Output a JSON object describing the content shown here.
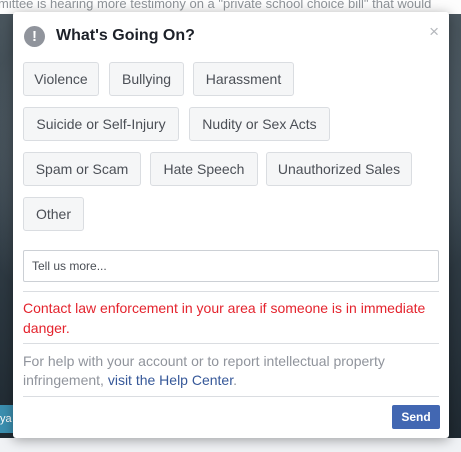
{
  "background": {
    "headline": "mittee is hearing more testimony on a \"private school choice bill\" that would",
    "left_tab_text": "ya"
  },
  "dialog": {
    "title": "What's Going On?",
    "alert_glyph": "!",
    "close_glyph": "×",
    "tags": [
      {
        "label": "Violence"
      },
      {
        "label": "Bullying"
      },
      {
        "label": "Harassment"
      },
      {
        "label": "Suicide or Self-Injury"
      },
      {
        "label": "Nudity or Sex Acts"
      },
      {
        "label": "Spam or Scam"
      },
      {
        "label": "Hate Speech"
      },
      {
        "label": "Unauthorized Sales"
      },
      {
        "label": "Other"
      }
    ],
    "details_placeholder": "Tell us more...",
    "warning": "Contact law enforcement in your area if someone is in immediate danger.",
    "help_text": "For help with your account or to report intellectual property infringement,",
    "help_link": "visit the Help Center",
    "help_suffix": ".",
    "send_label": "Send"
  },
  "colors": {
    "warning": "#e4232d",
    "link": "#365899",
    "primary_button": "#4267b2"
  }
}
